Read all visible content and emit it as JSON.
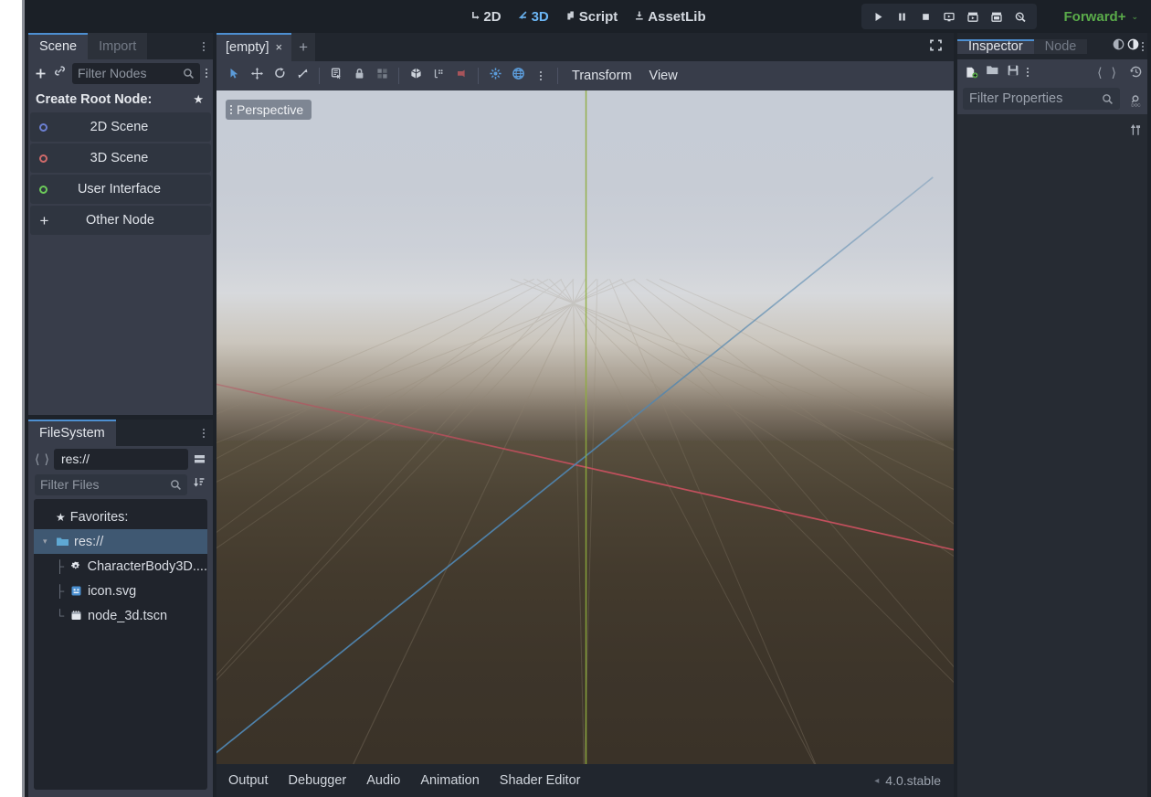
{
  "topbar": {
    "main_tabs": [
      {
        "label": "2D",
        "icon": "2d-icon",
        "active": false
      },
      {
        "label": "3D",
        "icon": "3d-icon",
        "active": true
      },
      {
        "label": "Script",
        "icon": "script-icon",
        "active": false
      },
      {
        "label": "AssetLib",
        "icon": "assetlib-icon",
        "active": false
      }
    ],
    "run_buttons": [
      {
        "name": "play-project-button",
        "icon": "play-icon"
      },
      {
        "name": "pause-project-button",
        "icon": "pause-icon"
      },
      {
        "name": "stop-project-button",
        "icon": "stop-icon"
      },
      {
        "name": "play-current-scene-button",
        "icon": "play-scene-icon"
      },
      {
        "name": "play-custom-scene-button",
        "icon": "play-custom-icon"
      },
      {
        "name": "movie-maker-mode-button",
        "icon": "movie-camera-icon"
      },
      {
        "name": "remote-debug-button",
        "icon": "remote-debug-icon"
      }
    ],
    "renderer": {
      "label": "Forward+",
      "color": "#5aab4a",
      "caret": "⌄"
    }
  },
  "scene_dock": {
    "tabs": [
      {
        "label": "Scene",
        "active": true
      },
      {
        "label": "Import",
        "active": false
      }
    ],
    "toolbar": {
      "add_node_label": "+",
      "instantiate_label": "link-icon",
      "filter_placeholder": "Filter Nodes"
    },
    "create_root": {
      "title": "Create Root Node:",
      "favorite_icon": "★",
      "items": [
        {
          "label": "2D Scene",
          "icon": "node2d-icon",
          "color": "#6b7fd1"
        },
        {
          "label": "3D Scene",
          "icon": "node3d-icon",
          "color": "#cf6a6a"
        },
        {
          "label": "User Interface",
          "icon": "control-icon",
          "color": "#6ccb5a"
        },
        {
          "label": "Other Node",
          "icon": "plus-icon",
          "color": "#dfe3e9"
        }
      ]
    }
  },
  "filesystem_dock": {
    "title": "FileSystem",
    "path_value": "res://",
    "filter_placeholder": "Filter Files",
    "tree": [
      {
        "label": "Favorites:",
        "icon": "star-icon",
        "depth": 0,
        "selected": false,
        "type": "header"
      },
      {
        "label": "res://",
        "icon": "folder-icon",
        "depth": 0,
        "selected": true,
        "type": "folder"
      },
      {
        "label": "CharacterBody3D....",
        "icon": "script-gear-icon",
        "depth": 1,
        "selected": false,
        "type": "file"
      },
      {
        "label": "icon.svg",
        "icon": "image-icon",
        "depth": 1,
        "selected": false,
        "type": "file"
      },
      {
        "label": "node_3d.tscn",
        "icon": "scene-icon",
        "depth": 1,
        "selected": false,
        "type": "file"
      }
    ]
  },
  "scene_tabs": {
    "tabs": [
      {
        "label": "[empty]",
        "close": "×",
        "active": true
      }
    ],
    "new_tab_label": "+",
    "expand_icon": "distraction-free-icon"
  },
  "viewport_toolbar": {
    "tools": [
      {
        "name": "select-mode-button",
        "icon": "cursor-icon",
        "active": true
      },
      {
        "name": "move-mode-button",
        "icon": "move-icon",
        "active": false
      },
      {
        "name": "rotate-mode-button",
        "icon": "rotate-icon",
        "active": false
      },
      {
        "name": "scale-mode-button",
        "icon": "scale-icon",
        "active": false
      },
      {
        "name": "list-select-button",
        "icon": "list-select-icon",
        "active": false
      },
      {
        "name": "lock-selection-button",
        "icon": "lock-icon",
        "active": false
      },
      {
        "name": "group-selection-button",
        "icon": "group-icon",
        "active": false
      },
      {
        "name": "snap-mode-button",
        "icon": "snap-cube-icon",
        "active": false
      },
      {
        "name": "snap-settings-button",
        "icon": "snap-settings-icon",
        "active": false
      },
      {
        "name": "camera-preview-button",
        "icon": "camera-icon",
        "active": false
      },
      {
        "name": "local-space-button",
        "icon": "local-space-icon",
        "active": false
      },
      {
        "name": "world-space-button",
        "icon": "globe-icon",
        "active": false
      },
      {
        "name": "more-options-button",
        "icon": "vertical-dots-icon",
        "active": false
      }
    ],
    "menus": [
      {
        "label": "Transform"
      },
      {
        "label": "View"
      }
    ]
  },
  "viewport": {
    "perspective_label": "Perspective",
    "perspective_menu_icon": "vertical-dots-icon",
    "axis_colors": {
      "x": "#c0495c",
      "y": "#8fae3c",
      "z": "#4a7fa8"
    },
    "grid_color": "#6d6354",
    "sky_top": "#c6ccd6",
    "ground_color": "#3d352a"
  },
  "bottom_bar": {
    "tabs": [
      {
        "label": "Output"
      },
      {
        "label": "Debugger"
      },
      {
        "label": "Audio"
      },
      {
        "label": "Animation"
      },
      {
        "label": "Shader Editor"
      }
    ],
    "version": "4.0.stable",
    "version_caret": "◂"
  },
  "inspector_dock": {
    "tabs": [
      {
        "label": "Inspector",
        "active": true
      },
      {
        "label": "Node",
        "active": false
      }
    ],
    "history_prev_icon": "history-prev-icon",
    "history_next_icon": "history-next-icon",
    "toolbar": [
      {
        "name": "new-resource-button",
        "icon": "new-resource-icon"
      },
      {
        "name": "load-resource-button",
        "icon": "open-folder-icon"
      },
      {
        "name": "save-resource-button",
        "icon": "save-icon"
      },
      {
        "name": "resource-extra-button",
        "icon": "vertical-dots-icon"
      }
    ],
    "nav_back_icon": "chevron-left-icon",
    "nav_forward_icon": "chevron-right-icon",
    "rail": [
      {
        "name": "history-button",
        "icon": "history-clock-icon"
      },
      {
        "name": "open-docs-button",
        "icon": "documentation-icon"
      },
      {
        "name": "object-tools-button",
        "icon": "tools-icon"
      }
    ],
    "filter_placeholder": "Filter Properties",
    "filter_search_icon": "search-icon",
    "filter_sort_icon": "sort-icon"
  }
}
